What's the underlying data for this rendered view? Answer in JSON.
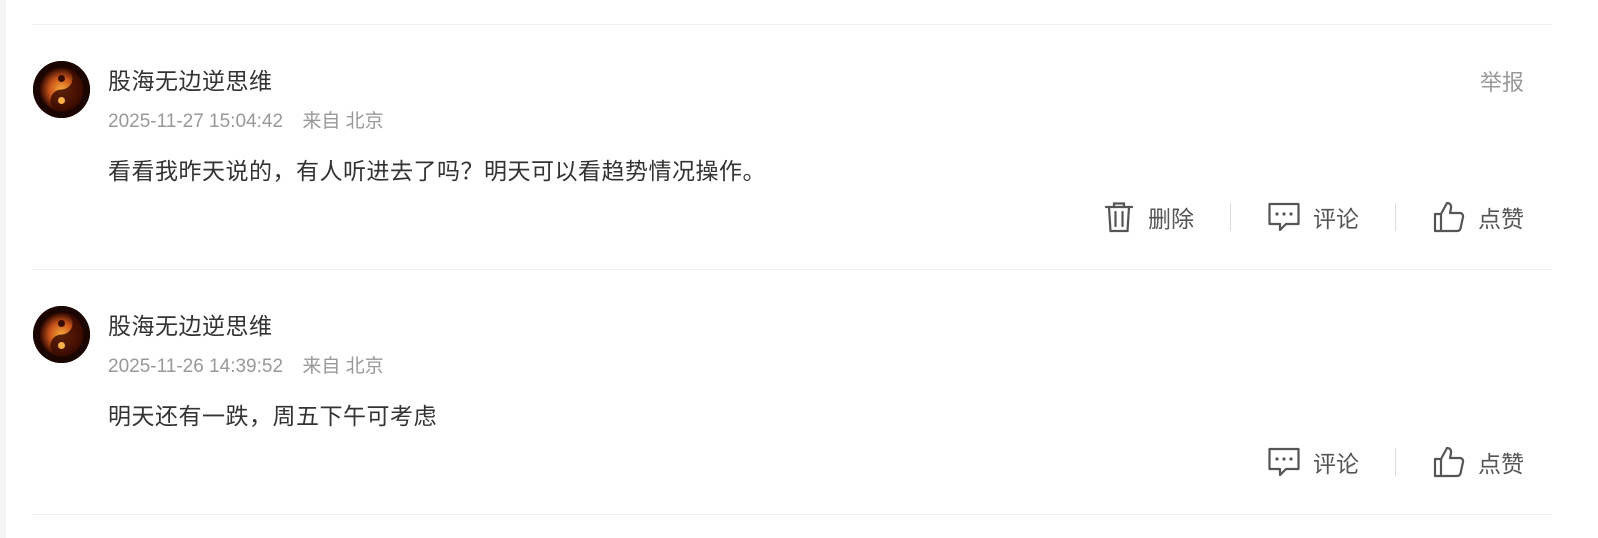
{
  "comments": [
    {
      "username": "股海无边逆思维",
      "time": "2025-11-27 15:04:42",
      "location": "来自 北京",
      "content": "看看我昨天说的，有人听进去了吗？明天可以看趋势情况操作。",
      "report_label": "举报",
      "delete_label": "删除",
      "reply_label": "评论",
      "like_label": "点赞"
    },
    {
      "username": "股海无边逆思维",
      "time": "2025-11-26 14:39:52",
      "location": "来自 北京",
      "content": "明天还有一跌，周五下午可考虑",
      "reply_label": "评论",
      "like_label": "点赞"
    }
  ],
  "icons": {
    "avatar": "yin-yang-fire-avatar",
    "delete": "trash-icon",
    "reply": "comment-bubble-icon",
    "like": "thumbs-up-icon"
  },
  "colors": {
    "primary_text": "#333333",
    "secondary_text": "#999999",
    "divider": "#efefef"
  }
}
